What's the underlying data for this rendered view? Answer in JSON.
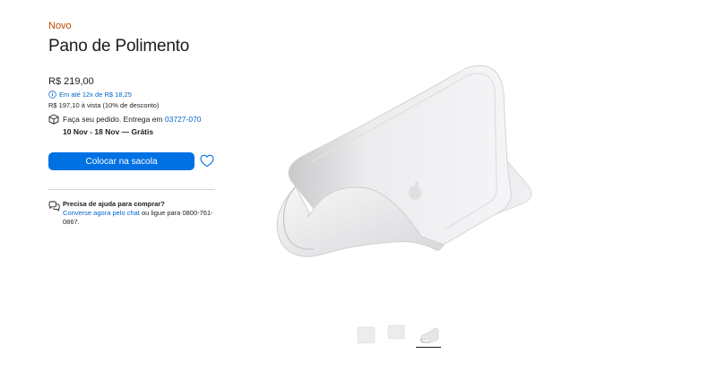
{
  "product": {
    "badge": "Novo",
    "title": "Pano de Polimento",
    "price": "R$ 219,00",
    "installments": "Em até 12x de R$ 18,25",
    "cash_price": "R$ 197,10 à vista (10% de desconto)"
  },
  "delivery": {
    "prefix": "Faça seu pedido. Entrega em",
    "zip": "03727-070",
    "dates": "10 Nov - 18 Nov — Grátis"
  },
  "actions": {
    "add_to_bag": "Colocar na sacola"
  },
  "help": {
    "title": "Precisa de ajuda para comprar?",
    "chat_link": "Converse agora pelo chat",
    "rest": "ou ligue para",
    "phone": "0800-761-0867."
  },
  "colors": {
    "badge": "#bf4800",
    "link": "#0066cc",
    "button": "#0071e3"
  },
  "icons": [
    "info-icon",
    "box-icon",
    "heart-icon",
    "chat-icon"
  ]
}
